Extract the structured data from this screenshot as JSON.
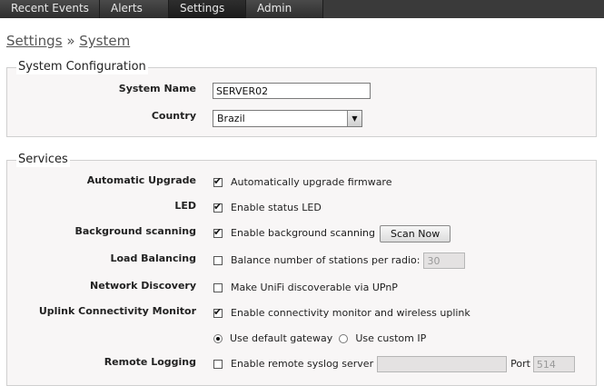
{
  "nav": {
    "tabs": [
      {
        "label": "Recent Events"
      },
      {
        "label": "Alerts"
      },
      {
        "label": "Settings"
      },
      {
        "label": "Admin"
      }
    ],
    "active": "Settings"
  },
  "breadcrumb": {
    "section": "Settings",
    "separator": "»",
    "page": "System"
  },
  "system_config": {
    "legend": "System Configuration",
    "system_name": {
      "label": "System Name",
      "value": "SERVER02"
    },
    "country": {
      "label": "Country",
      "value": "Brazil"
    }
  },
  "services": {
    "legend": "Services",
    "auto_upgrade": {
      "label": "Automatic Upgrade",
      "text": "Automatically upgrade firmware",
      "checked": true
    },
    "led": {
      "label": "LED",
      "text": "Enable status LED",
      "checked": true
    },
    "bg_scan": {
      "label": "Background scanning",
      "text": "Enable background scanning",
      "checked": true,
      "button": "Scan Now"
    },
    "load_balancing": {
      "label": "Load Balancing",
      "text": "Balance number of stations per radio:",
      "checked": false,
      "value": "30"
    },
    "net_discovery": {
      "label": "Network Discovery",
      "text": "Make UniFi discoverable via UPnP",
      "checked": false
    },
    "uplink": {
      "label": "Uplink Connectivity Monitor",
      "text": "Enable connectivity monitor and wireless uplink",
      "checked": true,
      "opt_default": "Use default gateway",
      "opt_custom": "Use custom IP",
      "selected": "default"
    },
    "remote_logging": {
      "label": "Remote Logging",
      "text": "Enable remote syslog server",
      "checked": false,
      "server": "",
      "port_label": "Port",
      "port": "514"
    }
  }
}
